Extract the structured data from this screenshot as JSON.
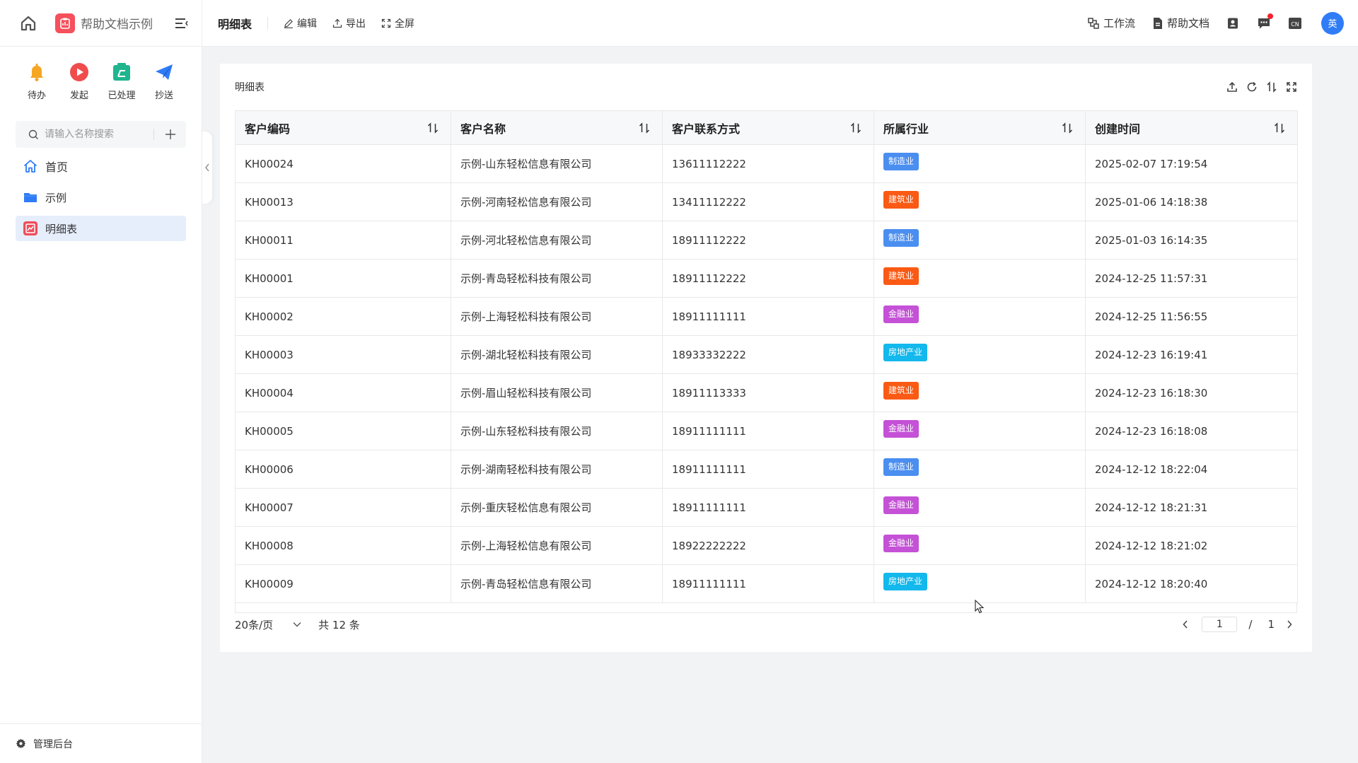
{
  "app": {
    "name": "帮助文档示例",
    "page_title": "明细表",
    "toolbar": {
      "edit": "编辑",
      "export": "导出",
      "fullscreen": "全屏"
    },
    "right": {
      "workflow": "工作流",
      "help": "帮助文档",
      "lang": "CN",
      "avatar": "英"
    }
  },
  "sidebar": {
    "quick": [
      {
        "label": "待办",
        "icon": "bell-icon",
        "color": "#f5a623"
      },
      {
        "label": "发起",
        "icon": "play-icon",
        "color": "#f04c4c"
      },
      {
        "label": "已处理",
        "icon": "done-icon",
        "color": "#1fb58f"
      },
      {
        "label": "抄送",
        "icon": "send-icon",
        "color": "#2f7cf6"
      }
    ],
    "search_placeholder": "请输入名称搜索",
    "nav": [
      {
        "label": "首页",
        "icon": "home-icon"
      },
      {
        "label": "示例",
        "icon": "folder-icon"
      },
      {
        "label": "明细表",
        "icon": "report-icon",
        "active": true
      }
    ],
    "footer": "管理后台"
  },
  "card": {
    "title": "明细表",
    "columns": [
      "客户编码",
      "客户名称",
      "客户联系方式",
      "所属行业",
      "创建时间"
    ],
    "rows": [
      {
        "code": "KH00024",
        "name": "示例-山东轻松信息有限公司",
        "phone": "13611112222",
        "industry": "制造业",
        "time": "2025-02-07 17:19:54"
      },
      {
        "code": "KH00013",
        "name": "示例-河南轻松信息有限公司",
        "phone": "13411112222",
        "industry": "建筑业",
        "time": "2025-01-06 14:18:38"
      },
      {
        "code": "KH00011",
        "name": "示例-河北轻松信息有限公司",
        "phone": "18911112222",
        "industry": "制造业",
        "time": "2025-01-03 16:14:35"
      },
      {
        "code": "KH00001",
        "name": "示例-青岛轻松科技有限公司",
        "phone": "18911112222",
        "industry": "建筑业",
        "time": "2024-12-25 11:57:31"
      },
      {
        "code": "KH00002",
        "name": "示例-上海轻松科技有限公司",
        "phone": "18911111111",
        "industry": "金融业",
        "time": "2024-12-25 11:56:55"
      },
      {
        "code": "KH00003",
        "name": "示例-湖北轻松科技有限公司",
        "phone": "18933332222",
        "industry": "房地产业",
        "time": "2024-12-23 16:19:41"
      },
      {
        "code": "KH00004",
        "name": "示例-眉山轻松科技有限公司",
        "phone": "18911113333",
        "industry": "建筑业",
        "time": "2024-12-23 16:18:30"
      },
      {
        "code": "KH00005",
        "name": "示例-山东轻松科技有限公司",
        "phone": "18911111111",
        "industry": "金融业",
        "time": "2024-12-23 16:18:08"
      },
      {
        "code": "KH00006",
        "name": "示例-湖南轻松科技有限公司",
        "phone": "18911111111",
        "industry": "制造业",
        "time": "2024-12-12 18:22:04"
      },
      {
        "code": "KH00007",
        "name": "示例-重庆轻松信息有限公司",
        "phone": "18911111111",
        "industry": "金融业",
        "time": "2024-12-12 18:21:31"
      },
      {
        "code": "KH00008",
        "name": "示例-上海轻松信息有限公司",
        "phone": "18922222222",
        "industry": "金融业",
        "time": "2024-12-12 18:21:02"
      },
      {
        "code": "KH00009",
        "name": "示例-青岛轻松信息有限公司",
        "phone": "18911111111",
        "industry": "房地产业",
        "time": "2024-12-12 18:20:40"
      }
    ],
    "industry_colors": {
      "制造业": "#4a8ef0",
      "建筑业": "#fa5a14",
      "金融业": "#c451d6",
      "房地产业": "#13b8ec"
    },
    "pager": {
      "page_size": "20条/页",
      "total": "共 12 条",
      "current": "1",
      "slash": "/",
      "pages": "1"
    }
  }
}
